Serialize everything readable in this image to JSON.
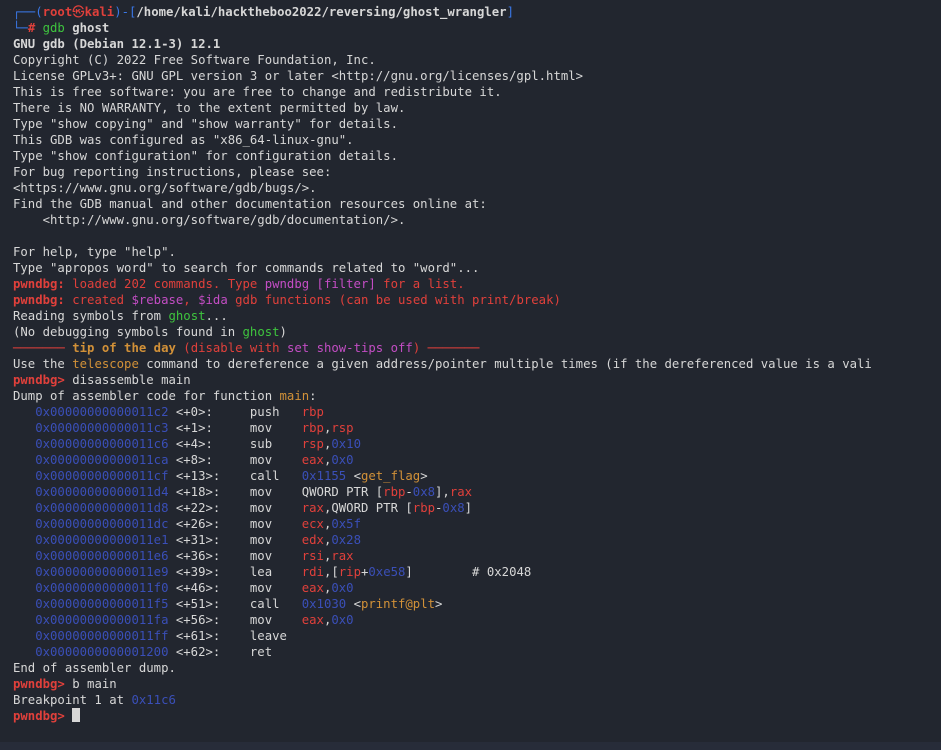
{
  "colors": {
    "text": "#d7d7d7",
    "blue": "#3a78e8",
    "red": "#e0403b",
    "green": "#3ec43e",
    "magenta": "#c34dc4",
    "orange": "#d29138",
    "addr": "#3a4fb8",
    "dim": "#4b5b9c"
  },
  "prompt": {
    "user": "root",
    "skull": "㉿",
    "host": "kali",
    "path": "/home/kali/hacktheboo2022/reversing/ghost_wrangler",
    "hash": "#",
    "command": "gdb",
    "argument": "ghost"
  },
  "lines": [
    [
      {
        "t": "┌──(",
        "c": "blue"
      },
      {
        "t": "root",
        "c": "red",
        "b": 1
      },
      {
        "t": "㉿",
        "c": "red"
      },
      {
        "t": "kali",
        "c": "red",
        "b": 1
      },
      {
        "t": ")-[",
        "c": "blue"
      },
      {
        "t": "/home/kali/hacktheboo2022/reversing/ghost_wrangler",
        "c": "text",
        "b": 1
      },
      {
        "t": "]",
        "c": "blue"
      }
    ],
    [
      {
        "t": "└─",
        "c": "blue"
      },
      {
        "t": "# ",
        "c": "red",
        "b": 1
      },
      {
        "t": "gdb ",
        "c": "green"
      },
      {
        "t": "ghost",
        "c": "text",
        "b": 1
      }
    ],
    [
      {
        "t": "GNU gdb (Debian 12.1-3) 12.1",
        "c": "text",
        "b": 1
      }
    ],
    [
      {
        "t": "Copyright (C) 2022 Free Software Foundation, Inc.",
        "c": "text"
      }
    ],
    [
      {
        "t": "License GPLv3+: GNU GPL version 3 or later <http://gnu.org/licenses/gpl.html>",
        "c": "text"
      }
    ],
    [
      {
        "t": "This is free software: you are free to change and redistribute it.",
        "c": "text"
      }
    ],
    [
      {
        "t": "There is NO WARRANTY, to the extent permitted by law.",
        "c": "text"
      }
    ],
    [
      {
        "t": "Type \"show copying\" and \"show warranty\" for details.",
        "c": "text"
      }
    ],
    [
      {
        "t": "This GDB was configured as \"x86_64-linux-gnu\".",
        "c": "text"
      }
    ],
    [
      {
        "t": "Type \"show configuration\" for configuration details.",
        "c": "text"
      }
    ],
    [
      {
        "t": "For bug reporting instructions, please see:",
        "c": "text"
      }
    ],
    [
      {
        "t": "<https://www.gnu.org/software/gdb/bugs/>.",
        "c": "text"
      }
    ],
    [
      {
        "t": "Find the GDB manual and other documentation resources online at:",
        "c": "text"
      }
    ],
    [
      {
        "t": "    <http://www.gnu.org/software/gdb/documentation/>.",
        "c": "text"
      }
    ],
    [
      {
        "t": "",
        "c": "text"
      }
    ],
    [
      {
        "t": "For help, type \"help\".",
        "c": "text"
      }
    ],
    [
      {
        "t": "Type \"apropos word\" to search for commands related to \"word\"...",
        "c": "text"
      }
    ],
    [
      {
        "t": "pwndbg:",
        "c": "red",
        "b": 1
      },
      {
        "t": " loaded 202 commands. Type ",
        "c": "red"
      },
      {
        "t": "pwndbg [filter]",
        "c": "magenta"
      },
      {
        "t": " for a list.",
        "c": "red"
      }
    ],
    [
      {
        "t": "pwndbg:",
        "c": "red",
        "b": 1
      },
      {
        "t": " created ",
        "c": "red"
      },
      {
        "t": "$rebase",
        "c": "magenta"
      },
      {
        "t": ", ",
        "c": "red"
      },
      {
        "t": "$ida",
        "c": "magenta"
      },
      {
        "t": " gdb functions (can be used with print/break)",
        "c": "red"
      }
    ],
    [
      {
        "t": "Reading symbols from ",
        "c": "text"
      },
      {
        "t": "ghost",
        "c": "green"
      },
      {
        "t": "...",
        "c": "text"
      }
    ],
    [
      {
        "t": "(No debugging symbols found in ",
        "c": "text"
      },
      {
        "t": "ghost",
        "c": "green"
      },
      {
        "t": ")",
        "c": "text"
      }
    ],
    [
      {
        "t": "─────── ",
        "c": "red"
      },
      {
        "t": "tip of the day",
        "c": "orange",
        "b": 1
      },
      {
        "t": " (disable with ",
        "c": "red"
      },
      {
        "t": "set show-tips off",
        "c": "magenta"
      },
      {
        "t": ") ───────",
        "c": "red"
      }
    ],
    [
      {
        "t": "Use the ",
        "c": "text"
      },
      {
        "t": "telescope",
        "c": "orange"
      },
      {
        "t": " command to dereference a given address/pointer multiple times (if the dereferenced value is a vali",
        "c": "text"
      }
    ],
    [
      {
        "t": "pwndbg>",
        "c": "red",
        "b": 1
      },
      {
        "t": " disassemble main",
        "c": "text"
      }
    ],
    [
      {
        "t": "Dump of assembler code for function ",
        "c": "text"
      },
      {
        "t": "main",
        "c": "orange"
      },
      {
        "t": ":",
        "c": "text"
      }
    ],
    [
      {
        "t": "   0x00000000000011c2 ",
        "c": "addr"
      },
      {
        "t": "<+0>:     push   ",
        "c": "text"
      },
      {
        "t": "rbp",
        "c": "red"
      }
    ],
    [
      {
        "t": "   0x00000000000011c3 ",
        "c": "addr"
      },
      {
        "t": "<+1>:     mov    ",
        "c": "text"
      },
      {
        "t": "rbp",
        "c": "red"
      },
      {
        "t": ",",
        "c": "text"
      },
      {
        "t": "rsp",
        "c": "red"
      }
    ],
    [
      {
        "t": "   0x00000000000011c6 ",
        "c": "addr"
      },
      {
        "t": "<+4>:     sub    ",
        "c": "text"
      },
      {
        "t": "rsp",
        "c": "red"
      },
      {
        "t": ",",
        "c": "text"
      },
      {
        "t": "0x10",
        "c": "addr"
      }
    ],
    [
      {
        "t": "   0x00000000000011ca ",
        "c": "addr"
      },
      {
        "t": "<+8>:     mov    ",
        "c": "text"
      },
      {
        "t": "eax",
        "c": "red"
      },
      {
        "t": ",",
        "c": "text"
      },
      {
        "t": "0x0",
        "c": "addr"
      }
    ],
    [
      {
        "t": "   0x00000000000011cf ",
        "c": "addr"
      },
      {
        "t": "<+13>:    call   ",
        "c": "text"
      },
      {
        "t": "0x1155 ",
        "c": "addr"
      },
      {
        "t": "<",
        "c": "text"
      },
      {
        "t": "get_flag",
        "c": "orange"
      },
      {
        "t": ">",
        "c": "text"
      }
    ],
    [
      {
        "t": "   0x00000000000011d4 ",
        "c": "addr"
      },
      {
        "t": "<+18>:    mov    QWORD PTR [",
        "c": "text"
      },
      {
        "t": "rbp",
        "c": "red"
      },
      {
        "t": "-",
        "c": "text"
      },
      {
        "t": "0x8",
        "c": "addr"
      },
      {
        "t": "],",
        "c": "text"
      },
      {
        "t": "rax",
        "c": "red"
      }
    ],
    [
      {
        "t": "   0x00000000000011d8 ",
        "c": "addr"
      },
      {
        "t": "<+22>:    mov    ",
        "c": "text"
      },
      {
        "t": "rax",
        "c": "red"
      },
      {
        "t": ",QWORD PTR [",
        "c": "text"
      },
      {
        "t": "rbp",
        "c": "red"
      },
      {
        "t": "-",
        "c": "text"
      },
      {
        "t": "0x8",
        "c": "addr"
      },
      {
        "t": "]",
        "c": "text"
      }
    ],
    [
      {
        "t": "   0x00000000000011dc ",
        "c": "addr"
      },
      {
        "t": "<+26>:    mov    ",
        "c": "text"
      },
      {
        "t": "ecx",
        "c": "red"
      },
      {
        "t": ",",
        "c": "text"
      },
      {
        "t": "0x5f",
        "c": "addr"
      }
    ],
    [
      {
        "t": "   0x00000000000011e1 ",
        "c": "addr"
      },
      {
        "t": "<+31>:    mov    ",
        "c": "text"
      },
      {
        "t": "edx",
        "c": "red"
      },
      {
        "t": ",",
        "c": "text"
      },
      {
        "t": "0x28",
        "c": "addr"
      }
    ],
    [
      {
        "t": "   0x00000000000011e6 ",
        "c": "addr"
      },
      {
        "t": "<+36>:    mov    ",
        "c": "text"
      },
      {
        "t": "rsi",
        "c": "red"
      },
      {
        "t": ",",
        "c": "text"
      },
      {
        "t": "rax",
        "c": "red"
      }
    ],
    [
      {
        "t": "   0x00000000000011e9 ",
        "c": "addr"
      },
      {
        "t": "<+39>:    lea    ",
        "c": "text"
      },
      {
        "t": "rdi",
        "c": "red"
      },
      {
        "t": ",[",
        "c": "text"
      },
      {
        "t": "rip",
        "c": "red"
      },
      {
        "t": "+",
        "c": "text"
      },
      {
        "t": "0xe58",
        "c": "addr"
      },
      {
        "t": "]        # 0x2048",
        "c": "text"
      }
    ],
    [
      {
        "t": "   0x00000000000011f0 ",
        "c": "addr"
      },
      {
        "t": "<+46>:    mov    ",
        "c": "text"
      },
      {
        "t": "eax",
        "c": "red"
      },
      {
        "t": ",",
        "c": "text"
      },
      {
        "t": "0x0",
        "c": "addr"
      }
    ],
    [
      {
        "t": "   0x00000000000011f5 ",
        "c": "addr"
      },
      {
        "t": "<+51>:    call   ",
        "c": "text"
      },
      {
        "t": "0x1030 ",
        "c": "addr"
      },
      {
        "t": "<",
        "c": "text"
      },
      {
        "t": "printf@plt",
        "c": "orange"
      },
      {
        "t": ">",
        "c": "text"
      }
    ],
    [
      {
        "t": "   0x00000000000011fa ",
        "c": "addr"
      },
      {
        "t": "<+56>:    mov    ",
        "c": "text"
      },
      {
        "t": "eax",
        "c": "red"
      },
      {
        "t": ",",
        "c": "text"
      },
      {
        "t": "0x0",
        "c": "addr"
      }
    ],
    [
      {
        "t": "   0x00000000000011ff ",
        "c": "addr"
      },
      {
        "t": "<+61>:    leave",
        "c": "text"
      }
    ],
    [
      {
        "t": "   0x0000000000001200 ",
        "c": "addr"
      },
      {
        "t": "<+62>:    ret",
        "c": "text"
      }
    ],
    [
      {
        "t": "End of assembler dump.",
        "c": "text"
      }
    ],
    [
      {
        "t": "pwndbg>",
        "c": "red",
        "b": 1
      },
      {
        "t": " b main",
        "c": "text"
      }
    ],
    [
      {
        "t": "Breakpoint 1 at ",
        "c": "text"
      },
      {
        "t": "0x11c6",
        "c": "addr"
      }
    ],
    [
      {
        "t": "pwndbg>",
        "c": "red",
        "b": 1
      },
      {
        "t": " ",
        "c": "text"
      }
    ]
  ]
}
